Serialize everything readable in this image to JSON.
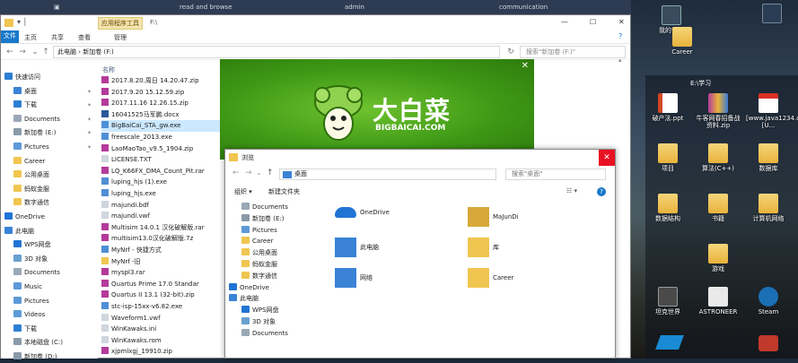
{
  "top_strip": {
    "items": [
      "read and browse",
      "admin",
      "communication"
    ]
  },
  "explorer": {
    "titlebar": {
      "tab": "F:\\",
      "min": "—",
      "max": "☐",
      "close": "✕"
    },
    "ribbon": {
      "tabs": [
        "文件",
        "主页",
        "共享",
        "查看",
        "管理"
      ],
      "tool_tab": "应用程序工具"
    },
    "address": {
      "path": "此电脑 › 新加卷 (F:)",
      "search_placeholder": "搜索\"新加卷 (F:)\""
    },
    "column_header": "名称",
    "nav_items": [
      {
        "label": "快速访问",
        "icon": "star"
      },
      {
        "label": "桌面",
        "icon": "desktop",
        "pinned": true
      },
      {
        "label": "下载",
        "icon": "download",
        "pinned": true
      },
      {
        "label": "Documents",
        "icon": "doc",
        "pinned": true
      },
      {
        "label": "新加卷 (E:)",
        "icon": "drive",
        "pinned": true
      },
      {
        "label": "Pictures",
        "icon": "pic",
        "pinned": true
      },
      {
        "label": "Career",
        "icon": "folder"
      },
      {
        "label": "公用桌面",
        "icon": "folder"
      },
      {
        "label": "蚂蚁金服",
        "icon": "folder"
      },
      {
        "label": "数字通信",
        "icon": "folder"
      },
      {
        "label": "OneDrive",
        "icon": "cloud"
      },
      {
        "label": "此电脑",
        "icon": "pc"
      },
      {
        "label": "WPS网盘",
        "icon": "cloud"
      },
      {
        "label": "3D 对象",
        "icon": "cube"
      },
      {
        "label": "Documents",
        "icon": "doc"
      },
      {
        "label": "Music",
        "icon": "music"
      },
      {
        "label": "Pictures",
        "icon": "pic"
      },
      {
        "label": "Videos",
        "icon": "video"
      },
      {
        "label": "下载",
        "icon": "download"
      },
      {
        "label": "本地磁盘 (C:)",
        "icon": "drive"
      },
      {
        "label": "新加卷 (D:)",
        "icon": "drive"
      }
    ],
    "files": [
      {
        "name": "2017.8.20.周日 14.20.47.zip",
        "icon": "zip"
      },
      {
        "name": "2017.9.20 15.12.59.zip",
        "icon": "zip"
      },
      {
        "name": "2017.11.16 12.26.15.zip",
        "icon": "zip"
      },
      {
        "name": "16041525马军鹏.docx",
        "icon": "docx"
      },
      {
        "name": "BigBaiCai_STA_gw.exe",
        "icon": "exe"
      },
      {
        "name": "freescale_2013.exe",
        "icon": "exe"
      },
      {
        "name": "LaoMaoTao_v9.5_1904.zip",
        "icon": "zip"
      },
      {
        "name": "LICENSE.TXT",
        "icon": "txt"
      },
      {
        "name": "LQ_K66FX_DMA_Count_Pit.rar",
        "icon": "zip"
      },
      {
        "name": "luping_hjs (1).exe",
        "icon": "exe"
      },
      {
        "name": "luping_hjs.exe",
        "icon": "exe"
      },
      {
        "name": "majundi.bdf",
        "icon": "txt"
      },
      {
        "name": "majundi.vwf",
        "icon": "txt"
      },
      {
        "name": "Multisim 14.0.1 汉化破解版.rar",
        "icon": "zip"
      },
      {
        "name": "multisim13.0汉化破解版.7z",
        "icon": "zip"
      },
      {
        "name": "MyNrf - 快捷方式",
        "icon": "link"
      },
      {
        "name": "MyNrf -旧",
        "icon": "folder"
      },
      {
        "name": "myspl3.rar",
        "icon": "zip"
      },
      {
        "name": "Quartus Prime 17.0 Standar",
        "icon": "zip"
      },
      {
        "name": "Quartus II 13.1 (32-bit).zip",
        "icon": "zip"
      },
      {
        "name": "stc-isp-15xx-v6.82.exe",
        "icon": "exe"
      },
      {
        "name": "Waveform1.vwf",
        "icon": "txt"
      },
      {
        "name": "WinKawaks.ini",
        "icon": "txt"
      },
      {
        "name": "WinKawaks.rom",
        "icon": "txt"
      },
      {
        "name": "xjpmlxgj_19910.zip",
        "icon": "zip"
      }
    ]
  },
  "splash": {
    "logo_text": "大白菜",
    "logo_sub": "BIGBAICAI.COM",
    "close": "✕"
  },
  "dialog": {
    "title": "浏览",
    "close": "✕",
    "address": "桌面",
    "search_placeholder": "搜索\"桌面\"",
    "toolbar": {
      "organize": "组织 ▾",
      "new_folder": "新建文件夹"
    },
    "nav_items": [
      {
        "label": "Documents",
        "icon": "doc"
      },
      {
        "label": "新加卷 (E:)",
        "icon": "drive"
      },
      {
        "label": "Pictures",
        "icon": "pic"
      },
      {
        "label": "Career",
        "icon": "folder"
      },
      {
        "label": "公用桌面",
        "icon": "folder"
      },
      {
        "label": "蚂蚁金服",
        "icon": "folder"
      },
      {
        "label": "数字通信",
        "icon": "folder"
      },
      {
        "label": "OneDrive",
        "icon": "cloud"
      },
      {
        "label": "此电脑",
        "icon": "pc"
      },
      {
        "label": "WPS网盘",
        "icon": "cloud"
      },
      {
        "label": "3D 对象",
        "icon": "cube"
      },
      {
        "label": "Documents",
        "icon": "doc"
      }
    ],
    "items": [
      {
        "label": "OneDrive",
        "icon": "cloud"
      },
      {
        "label": "MaJunDi",
        "icon": "user"
      },
      {
        "label": "此电脑",
        "icon": "pc"
      },
      {
        "label": "库",
        "icon": "folder"
      },
      {
        "label": "网络",
        "icon": "network"
      },
      {
        "label": "Career",
        "icon": "folder"
      }
    ]
  },
  "desktop": {
    "title": "E:\\学习",
    "icons": [
      {
        "label": "Career",
        "icon": "folder"
      },
      {
        "label": "破产法.ppt",
        "icon": "ppt"
      },
      {
        "label": "牛客网春招备战资料.zip",
        "icon": "zip"
      },
      {
        "label": "[www.java1234.com][U...",
        "icon": "pdf"
      },
      {
        "label": "项目",
        "icon": "folder"
      },
      {
        "label": "算法(C++)",
        "icon": "folder"
      },
      {
        "label": "数据库",
        "icon": "folder"
      },
      {
        "label": "数据结构",
        "icon": "folder"
      },
      {
        "label": "书籍",
        "icon": "folder"
      },
      {
        "label": "计算机网络",
        "icon": "folder"
      },
      {
        "label": "游戏",
        "icon": "folder"
      },
      {
        "label": "坦克世界",
        "icon": "game"
      },
      {
        "label": "ASTRONEER",
        "icon": "game"
      },
      {
        "label": "Steam",
        "icon": "steam"
      },
      {
        "label": "我的世界",
        "icon": "game"
      }
    ]
  },
  "colors": {
    "tool_tab": "#f3e4b0",
    "splash_green": "#4aa31c",
    "close_red": "#e81123",
    "folder_yellow": "#f0c650",
    "link_blue": "#0063b1"
  }
}
